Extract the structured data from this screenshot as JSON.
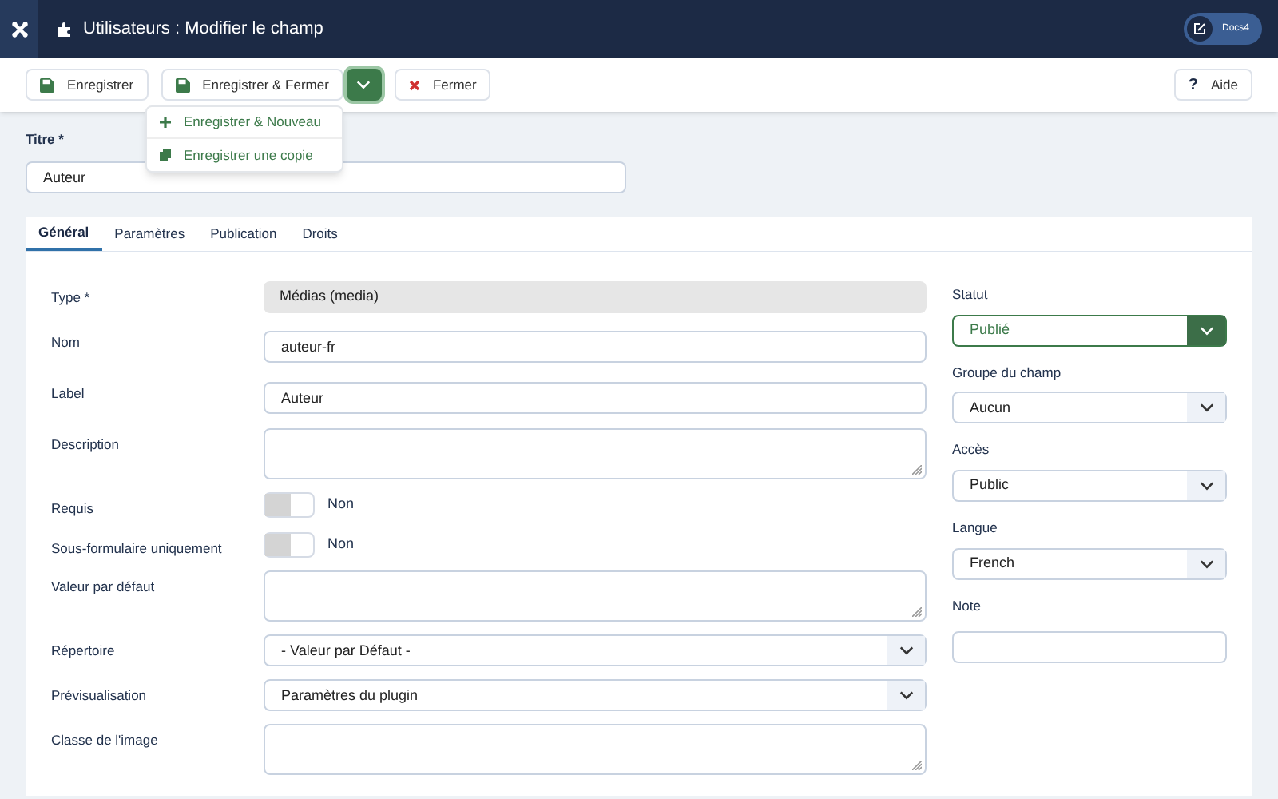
{
  "header": {
    "title": "Utilisateurs : Modifier le champ",
    "user_button": "Docs4"
  },
  "toolbar": {
    "buttons": [
      {
        "label": "Enregistrer",
        "kind": "save"
      },
      {
        "label": "Enregistrer & Fermer",
        "kind": "save-split",
        "expanded": true
      },
      {
        "label": "Fermer",
        "kind": "close"
      }
    ],
    "help": "Aide",
    "help_icon": "?",
    "menu": [
      {
        "label": "Enregistrer & Nouveau",
        "kind": "new"
      },
      {
        "label": "Enregistrer une copie",
        "kind": "copy"
      }
    ]
  },
  "title_field": {
    "label": "Titre *",
    "value": "Auteur"
  },
  "tabs": [
    {
      "label": "Général",
      "selected": true
    },
    {
      "label": "Paramètres",
      "selected": false
    },
    {
      "label": "Publication",
      "selected": false
    },
    {
      "label": "Droits",
      "selected": false
    }
  ],
  "fields": [
    {
      "label": "Type *",
      "kind": "readonly",
      "value": "Médias (media)"
    },
    {
      "label": "Nom",
      "kind": "text",
      "value": "auteur-fr"
    },
    {
      "label": "Label",
      "kind": "text",
      "value": "Auteur"
    },
    {
      "label": "Description",
      "kind": "textarea"
    },
    {
      "label": "Requis",
      "kind": "toggle",
      "on": false,
      "value": "Non"
    },
    {
      "label": "Sous-formulaire uniquement",
      "kind": "toggle",
      "on": false,
      "value": "Non"
    },
    {
      "label": "Valeur par défaut",
      "kind": "textarea"
    },
    {
      "label": "Répertoire",
      "kind": "select",
      "value": "- Valeur par Défaut -"
    },
    {
      "label": "Prévisualisation",
      "kind": "select",
      "value": "Paramètres du plugin"
    },
    {
      "label": "Classe de l'image",
      "kind": "textarea"
    }
  ],
  "side_fields": [
    {
      "label": "Statut",
      "kind": "status",
      "value": "Publié"
    },
    {
      "label": "Groupe du champ",
      "kind": "select",
      "value": "Aucun"
    },
    {
      "label": "Accès",
      "kind": "select",
      "value": "Public"
    },
    {
      "label": "Langue",
      "kind": "select",
      "value": "French"
    },
    {
      "label": "Note",
      "kind": "text"
    }
  ]
}
